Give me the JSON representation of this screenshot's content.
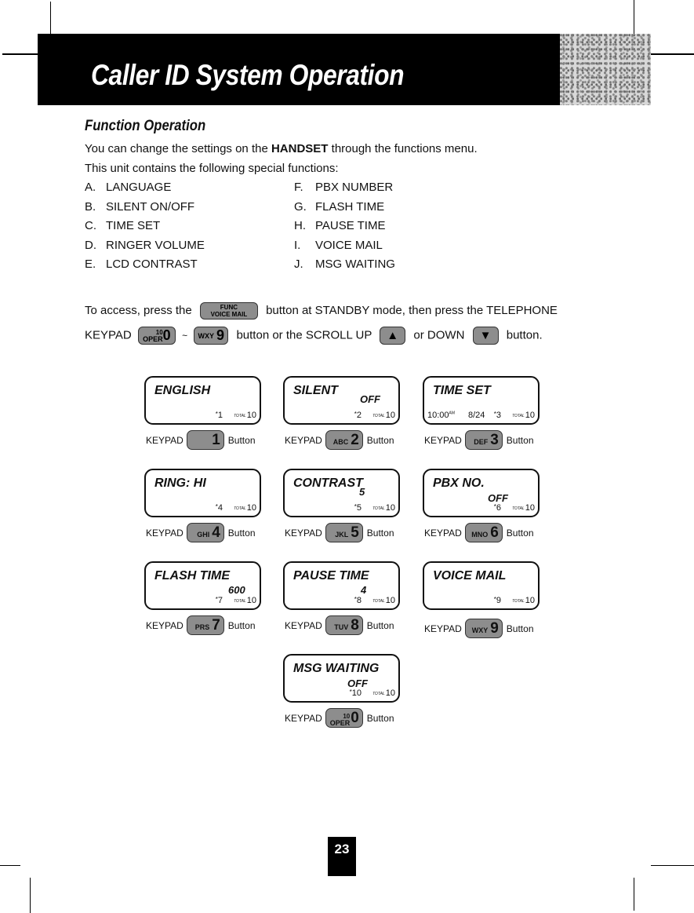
{
  "header": {
    "title": "Caller ID System Operation"
  },
  "section": {
    "title": "Function Operation",
    "intro_pre": "You can change the settings on the ",
    "intro_bold": "HANDSET",
    "intro_post": " through the functions menu.",
    "intro2": "This unit contains the following special functions:"
  },
  "functions_left": [
    {
      "letter": "A.",
      "label": "LANGUAGE"
    },
    {
      "letter": "B.",
      "label": "SILENT ON/OFF"
    },
    {
      "letter": "C.",
      "label": "TIME SET"
    },
    {
      "letter": "D.",
      "label": "RINGER VOLUME"
    },
    {
      "letter": "E.",
      "label": "LCD CONTRAST"
    }
  ],
  "functions_right": [
    {
      "letter": "F.",
      "label": "PBX NUMBER"
    },
    {
      "letter": "G.",
      "label": "FLASH TIME"
    },
    {
      "letter": "H.",
      "label": "PAUSE TIME"
    },
    {
      "letter": "I.",
      "label": "VOICE MAIL"
    },
    {
      "letter": "J.",
      "label": "MSG WAITING"
    }
  ],
  "access": {
    "t1": "To  access,  press  the",
    "func_key_top": "FUNC",
    "func_key_bottom": "VOICE MAIL",
    "t2": "button  at  STANDBY  mode,  then  press  the  TELEPHONE",
    "t3": "KEYPAD",
    "tilde": "~",
    "t4": "button or the SCROLL  UP",
    "t5": "or DOWN",
    "t6": "button.",
    "key0_ten": "10",
    "key0_word": "OPER",
    "key0_digit": "0",
    "key9_letters": "WXY",
    "key9_digit": "9",
    "up_arrow": "▲",
    "down_arrow": "▼"
  },
  "keypad_label": "KEYPAD",
  "button_label": "Button",
  "total_label": "TOTAL",
  "screens": [
    {
      "title": "ENGLISH",
      "value": "",
      "index": "1",
      "total": "10",
      "letters": "",
      "digit": "1"
    },
    {
      "title": "SILENT",
      "value": "OFF",
      "index": "2",
      "total": "10",
      "letters": "ABC",
      "digit": "2"
    },
    {
      "title": "TIME SET",
      "value": "",
      "index": "3",
      "total": "10",
      "letters": "DEF",
      "digit": "3",
      "time": "10:00",
      "ampm": "AM",
      "date": "8/24"
    },
    {
      "title": "RING: HI",
      "value": "",
      "index": "4",
      "total": "10",
      "letters": "GHI",
      "digit": "4"
    },
    {
      "title": "CONTRAST",
      "value": "5",
      "index": "5",
      "total": "10",
      "letters": "JKL",
      "digit": "5"
    },
    {
      "title": "PBX NO.",
      "value": "OFF",
      "index": "6",
      "total": "10",
      "letters": "MNO",
      "digit": "6"
    },
    {
      "title": "FLASH TIME",
      "value": "600",
      "index": "7",
      "total": "10",
      "letters": "PRS",
      "digit": "7"
    },
    {
      "title": "PAUSE TIME",
      "value": "4",
      "index": "8",
      "total": "10",
      "letters": "TUV",
      "digit": "8"
    },
    {
      "title": "VOICE MAIL",
      "value": "",
      "index": "9",
      "total": "10",
      "letters": "WXY",
      "digit": "9"
    },
    {
      "title": "MSG WAITING",
      "value": "OFF",
      "index": "10",
      "total": "10",
      "letters": "",
      "digit": "0",
      "ten": "10",
      "word": "OPER"
    }
  ],
  "page_number": "23"
}
